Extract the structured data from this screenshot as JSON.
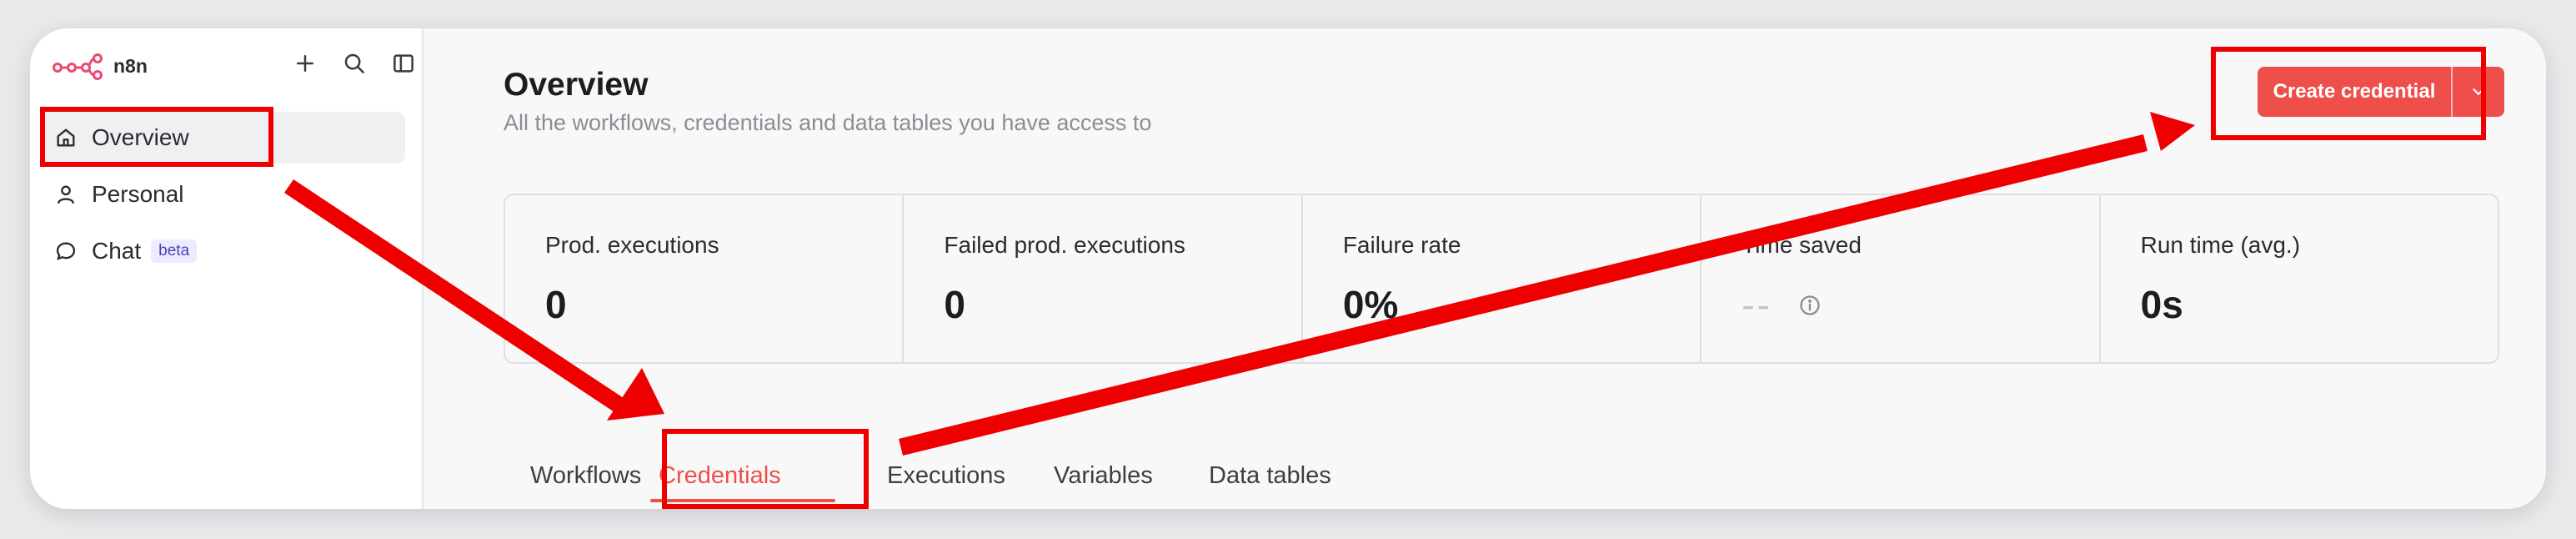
{
  "app": {
    "name": "n8n"
  },
  "sidebar": {
    "items": [
      {
        "label": "Overview",
        "icon": "home-icon"
      },
      {
        "label": "Personal",
        "icon": "user-icon"
      },
      {
        "label": "Chat",
        "icon": "chat-bubble-icon",
        "badge": "beta"
      }
    ],
    "top_icons": [
      "plus-icon",
      "search-icon",
      "sidebar-toggle-icon"
    ]
  },
  "header": {
    "title": "Overview",
    "subtitle": "All the workflows, credentials and data tables you have access to",
    "create_button": "Create credential"
  },
  "stats": [
    {
      "label": "Prod. executions",
      "value": "0"
    },
    {
      "label": "Failed prod. executions",
      "value": "0"
    },
    {
      "label": "Failure rate",
      "value": "0%"
    },
    {
      "label": "Time saved",
      "value": "--"
    },
    {
      "label": "Run time (avg.)",
      "value": "0s"
    }
  ],
  "tabs": [
    {
      "label": "Workflows"
    },
    {
      "label": "Credentials",
      "active": true
    },
    {
      "label": "Executions"
    },
    {
      "label": "Variables"
    },
    {
      "label": "Data tables"
    }
  ],
  "colors": {
    "accent": "#ee4f4a",
    "annotation": "#ee0000",
    "logo": "#ea4b71"
  }
}
